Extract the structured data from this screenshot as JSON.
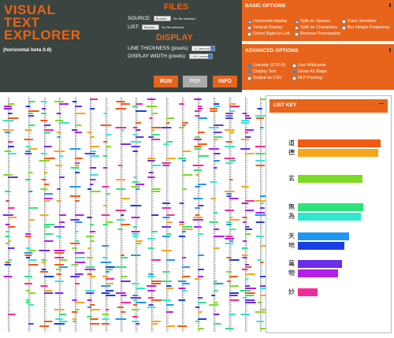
{
  "app": {
    "title_lines": [
      "VISUAL",
      "TEXT",
      "EXPLORER"
    ],
    "version": "(horizontal beta 0.8)"
  },
  "files": {
    "title": "FILES",
    "source_label": "SOURCE:",
    "list_label": "LIST:",
    "browse_label": "Browse...",
    "no_file_text": "No file selected."
  },
  "display": {
    "title": "DISPLAY",
    "thickness_label": "LINE THICKNESS (pixels):",
    "thickness_value": "12 (default)",
    "width_label": "DISPLAY WIDTH (pixels):",
    "width_value": "1000 (default)"
  },
  "buttons": {
    "run": "RUN",
    "pdf": "PDF",
    "info": "INFO"
  },
  "basic_options": {
    "title": "BASIC OPTIONS",
    "items": [
      {
        "label": "Horizontal display",
        "type": "radio",
        "checked": true
      },
      {
        "label": "Split on Spaces",
        "type": "radio",
        "checked": true
      },
      {
        "label": "Case Sensitive",
        "type": "checkbox",
        "checked": false
      },
      {
        "label": "Vertical Display",
        "type": "radio",
        "checked": false
      },
      {
        "label": "Split on Characters",
        "type": "radio",
        "checked": false
      },
      {
        "label": "Bar Height Frequency",
        "type": "checkbox",
        "checked": false
      },
      {
        "label": "Orient Right-to-Left",
        "type": "checkbox",
        "checked": false
      },
      {
        "label": "Remove Punctuation",
        "type": "checkbox",
        "checked": false
      }
    ]
  },
  "advanced_options": {
    "title": "ADVANCED OPTIONS",
    "items": [
      {
        "label": "Unicode (UTF-8)",
        "checked": true
      },
      {
        "label": "Use Wildcards",
        "checked": false
      },
      {
        "label": "Display Text",
        "checked": true
      },
      {
        "label": "Show All Steps",
        "checked": true
      },
      {
        "label": "Output as CSV",
        "checked": false
      },
      {
        "label": "NLP Parsing",
        "checked": false
      }
    ]
  },
  "list_key": {
    "title": "LIST KEY",
    "groups": [
      {
        "chars": [
          "道",
          "德"
        ],
        "colors": [
          "#ef5a14",
          "#f7a51b"
        ],
        "freq": [
          0.97,
          0.94
        ]
      },
      {
        "chars": [
          "玄"
        ],
        "colors": [
          "#7ddb21"
        ],
        "freq": [
          0.76
        ]
      },
      {
        "chars": [
          "無",
          "為"
        ],
        "colors": [
          "#2fe27c",
          "#30e7d0"
        ],
        "freq": [
          0.77,
          0.74
        ]
      },
      {
        "chars": [
          "天",
          "地"
        ],
        "colors": [
          "#2196ef",
          "#1a3fe0"
        ],
        "freq": [
          0.6,
          0.55
        ]
      },
      {
        "chars": [
          "萬",
          "物"
        ],
        "colors": [
          "#6b2ee8",
          "#b21fe6"
        ],
        "freq": [
          0.52,
          0.47
        ]
      },
      {
        "chars": [
          "妙"
        ],
        "colors": [
          "#f22b9b"
        ],
        "freq": [
          0.23
        ]
      }
    ]
  }
}
